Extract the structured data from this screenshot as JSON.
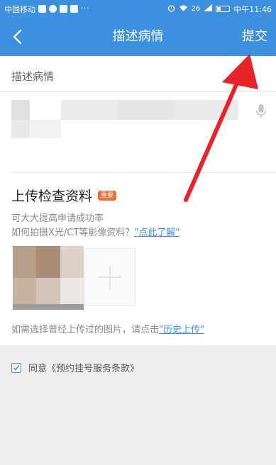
{
  "status_bar": {
    "carrier": "中国移动",
    "dots": "···",
    "network": "26",
    "time": "中午11:46"
  },
  "header": {
    "title": "描述病情",
    "submit_label": "提交"
  },
  "description": {
    "label": "描述病情"
  },
  "upload": {
    "title": "上传检查资料",
    "badge": "重要",
    "hint_success": "可大大提高申请成功率",
    "hint_howto_prefix": "如何拍摄X光/CT等影像资料？",
    "hint_howto_link": "\"点此了解\"",
    "history_prefix": "如需选择曾经上传过的图片，请点击",
    "history_link": "\"历史上传\""
  },
  "agreement": {
    "label": "同意《预约挂号服务条款》",
    "checked": true
  },
  "colors": {
    "primary": "#3d8fe0",
    "badge": "#f26b3a",
    "annotation_arrow": "#e8242a"
  }
}
